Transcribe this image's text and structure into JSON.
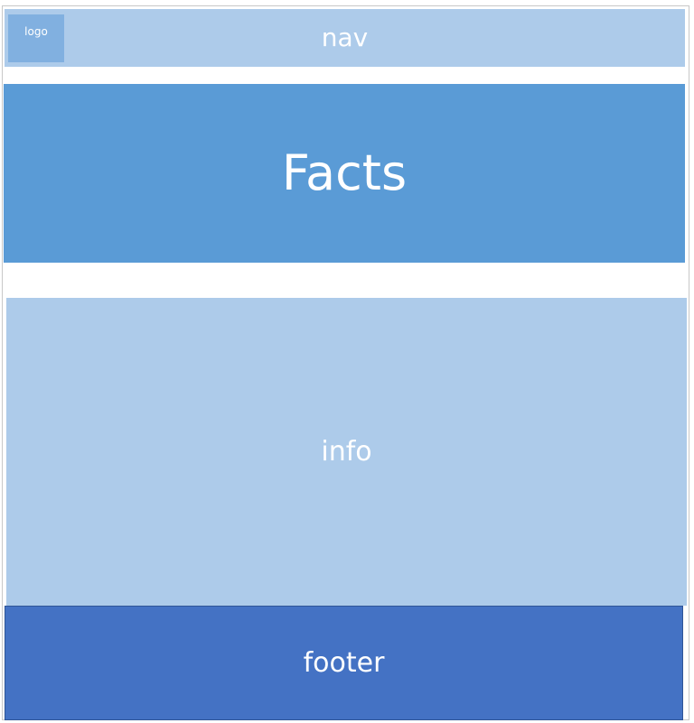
{
  "nav": {
    "label": "nav"
  },
  "logo": {
    "label": "logo"
  },
  "hero": {
    "label": "Facts"
  },
  "info": {
    "label": "info"
  },
  "footer": {
    "label": "footer"
  },
  "colors": {
    "nav": "#adcbea",
    "logo": "#81b0e0",
    "hero": "#5a9bd6",
    "info": "#adcbea",
    "footer": "#4472c4"
  }
}
